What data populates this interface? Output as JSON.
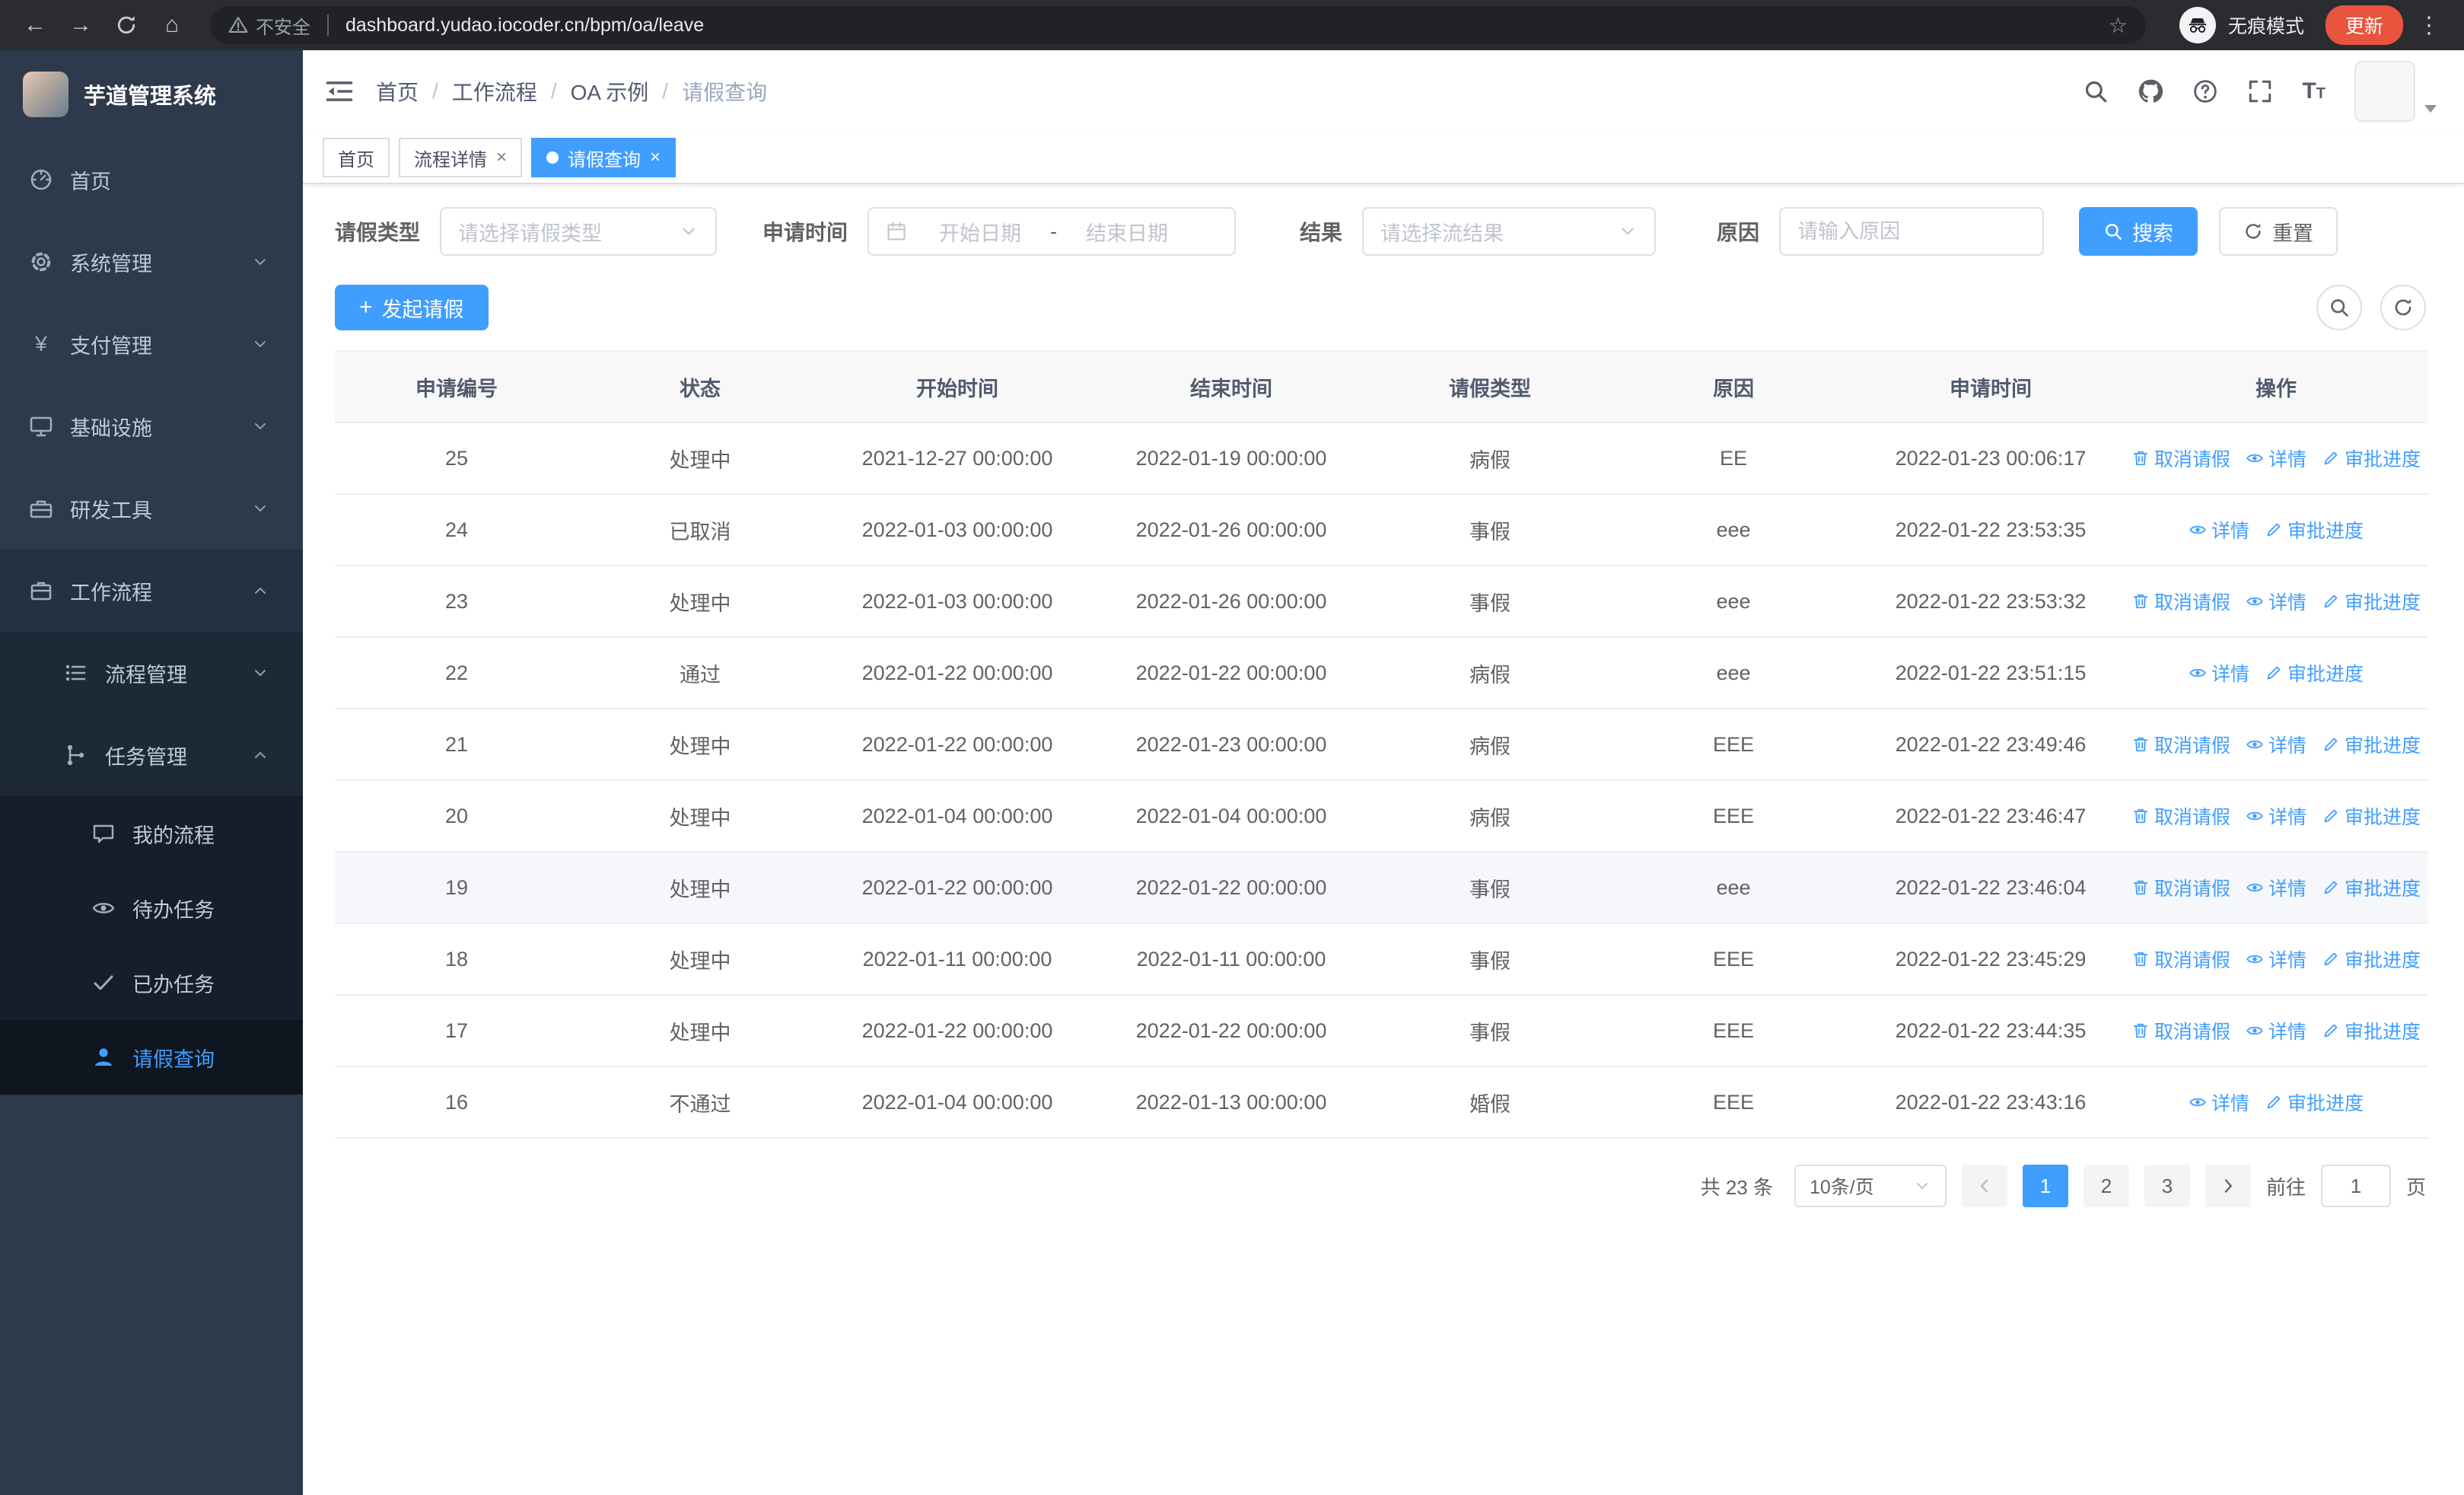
{
  "browser": {
    "security_warning": "不安全",
    "url": "dashboard.yudao.iocoder.cn/bpm/oa/leave",
    "incognito_label": "无痕模式",
    "update_label": "更新",
    "back_glyph": "←",
    "forward_glyph": "→",
    "home_glyph": "⌂",
    "star_glyph": "☆",
    "menu_glyph": "⋮"
  },
  "sidebar": {
    "app_title": "芋道管理系统",
    "menu": [
      {
        "name": "home",
        "label": "首页",
        "icon": "dashboard-icon",
        "level": 1
      },
      {
        "name": "system-management",
        "label": "系统管理",
        "icon": "gear-icon",
        "level": 1,
        "chevron": "down"
      },
      {
        "name": "payment-management",
        "label": "支付管理",
        "icon": "yen-icon",
        "level": 1,
        "chevron": "down"
      },
      {
        "name": "infrastructure",
        "label": "基础设施",
        "icon": "monitor-icon",
        "level": 1,
        "chevron": "down"
      },
      {
        "name": "dev-tools",
        "label": "研发工具",
        "icon": "toolbox-icon",
        "level": 1,
        "chevron": "down"
      },
      {
        "name": "workflow",
        "label": "工作流程",
        "icon": "briefcase-icon",
        "level": 1,
        "chevron": "up",
        "open": true
      },
      {
        "name": "process-management",
        "label": "流程管理",
        "icon": "list-icon",
        "level": 2,
        "chevron": "down"
      },
      {
        "name": "task-management",
        "label": "任务管理",
        "icon": "branch-icon",
        "level": 2,
        "chevron": "up",
        "open": true
      },
      {
        "name": "my-processes",
        "label": "我的流程",
        "icon": "chat-icon",
        "level": 3
      },
      {
        "name": "todo-tasks",
        "label": "待办任务",
        "icon": "eye-icon",
        "level": 3
      },
      {
        "name": "done-tasks",
        "label": "已办任务",
        "icon": "check-icon",
        "level": 3
      },
      {
        "name": "leave-query",
        "label": "请假查询",
        "icon": "user-icon",
        "level": 3,
        "active": true
      }
    ]
  },
  "header": {
    "breadcrumb": [
      "首页",
      "工作流程",
      "OA 示例",
      "请假查询"
    ]
  },
  "tabs": [
    {
      "name": "home",
      "label": "首页",
      "closable": false,
      "active": false
    },
    {
      "name": "process-detail",
      "label": "流程详情",
      "closable": true,
      "active": false
    },
    {
      "name": "leave-query",
      "label": "请假查询",
      "closable": true,
      "active": true
    }
  ],
  "filters": {
    "leave_type_label": "请假类型",
    "leave_type_placeholder": "请选择请假类型",
    "apply_time_label": "申请时间",
    "start_date_placeholder": "开始日期",
    "range_separator": "-",
    "end_date_placeholder": "结束日期",
    "result_label": "结果",
    "result_placeholder": "请选择流结果",
    "reason_label": "原因",
    "reason_placeholder": "请输入原因",
    "search_button": "搜索",
    "reset_button": "重置"
  },
  "toolbar": {
    "create_button": "发起请假"
  },
  "table": {
    "columns": [
      "申请编号",
      "状态",
      "开始时间",
      "结束时间",
      "请假类型",
      "原因",
      "申请时间",
      "操作"
    ],
    "action_defs": {
      "cancel": {
        "label": "取消请假",
        "icon": "delete-icon",
        "name": "cancel-leave-link"
      },
      "detail": {
        "label": "详情",
        "icon": "view-icon",
        "name": "detail-link"
      },
      "progress": {
        "label": "审批进度",
        "icon": "edit-icon",
        "name": "approval-progress-link"
      }
    },
    "rows": [
      {
        "id": "25",
        "status": "处理中",
        "start": "2021-12-27 00:00:00",
        "end": "2022-01-19 00:00:00",
        "type": "病假",
        "reason": "EE",
        "applied": "2022-01-23 00:06:17",
        "actions": [
          "cancel",
          "detail",
          "progress"
        ]
      },
      {
        "id": "24",
        "status": "已取消",
        "start": "2022-01-03 00:00:00",
        "end": "2022-01-26 00:00:00",
        "type": "事假",
        "reason": "eee",
        "applied": "2022-01-22 23:53:35",
        "actions": [
          "detail",
          "progress"
        ]
      },
      {
        "id": "23",
        "status": "处理中",
        "start": "2022-01-03 00:00:00",
        "end": "2022-01-26 00:00:00",
        "type": "事假",
        "reason": "eee",
        "applied": "2022-01-22 23:53:32",
        "actions": [
          "cancel",
          "detail",
          "progress"
        ]
      },
      {
        "id": "22",
        "status": "通过",
        "start": "2022-01-22 00:00:00",
        "end": "2022-01-22 00:00:00",
        "type": "病假",
        "reason": "eee",
        "applied": "2022-01-22 23:51:15",
        "actions": [
          "detail",
          "progress"
        ]
      },
      {
        "id": "21",
        "status": "处理中",
        "start": "2022-01-22 00:00:00",
        "end": "2022-01-23 00:00:00",
        "type": "病假",
        "reason": "EEE",
        "applied": "2022-01-22 23:49:46",
        "actions": [
          "cancel",
          "detail",
          "progress"
        ]
      },
      {
        "id": "20",
        "status": "处理中",
        "start": "2022-01-04 00:00:00",
        "end": "2022-01-04 00:00:00",
        "type": "病假",
        "reason": "EEE",
        "applied": "2022-01-22 23:46:47",
        "actions": [
          "cancel",
          "detail",
          "progress"
        ]
      },
      {
        "id": "19",
        "status": "处理中",
        "start": "2022-01-22 00:00:00",
        "end": "2022-01-22 00:00:00",
        "type": "事假",
        "reason": "eee",
        "applied": "2022-01-22 23:46:04",
        "actions": [
          "cancel",
          "detail",
          "progress"
        ],
        "highlighted": true
      },
      {
        "id": "18",
        "status": "处理中",
        "start": "2022-01-11 00:00:00",
        "end": "2022-01-11 00:00:00",
        "type": "事假",
        "reason": "EEE",
        "applied": "2022-01-22 23:45:29",
        "actions": [
          "cancel",
          "detail",
          "progress"
        ]
      },
      {
        "id": "17",
        "status": "处理中",
        "start": "2022-01-22 00:00:00",
        "end": "2022-01-22 00:00:00",
        "type": "事假",
        "reason": "EEE",
        "applied": "2022-01-22 23:44:35",
        "actions": [
          "cancel",
          "detail",
          "progress"
        ]
      },
      {
        "id": "16",
        "status": "不通过",
        "start": "2022-01-04 00:00:00",
        "end": "2022-01-13 00:00:00",
        "type": "婚假",
        "reason": "EEE",
        "applied": "2022-01-22 23:43:16",
        "actions": [
          "detail",
          "progress"
        ]
      }
    ]
  },
  "pagination": {
    "total": "共 23 条",
    "page_size": "10条/页",
    "pages": [
      "1",
      "2",
      "3"
    ],
    "active_page": "1",
    "goto_label": "前往",
    "goto_value": "1",
    "goto_suffix": "页"
  },
  "colors": {
    "primary": "#409eff",
    "sidebar_bg": "#2d3a4b",
    "tab_active_bg": "#409eff",
    "update_pill_bg": "#e8543e"
  }
}
